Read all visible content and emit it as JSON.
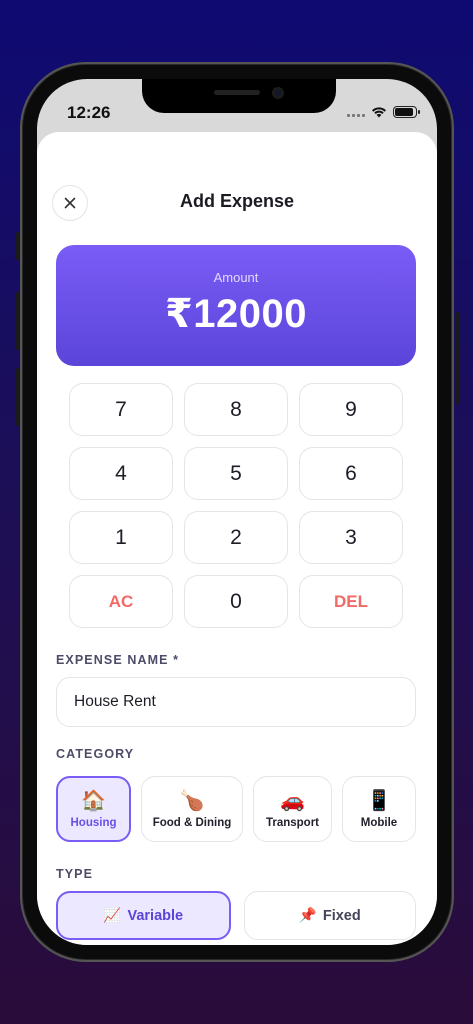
{
  "status": {
    "time": "12:26"
  },
  "header": {
    "title": "Add Expense",
    "close_icon": "close-icon"
  },
  "amount": {
    "label": "Amount",
    "value": "₹12000"
  },
  "keypad": {
    "keys": [
      "7",
      "8",
      "9",
      "4",
      "5",
      "6",
      "1",
      "2",
      "3",
      "AC",
      "0",
      "DEL"
    ]
  },
  "expense_name": {
    "label": "EXPENSE NAME *",
    "value": "House Rent"
  },
  "category": {
    "label": "CATEGORY",
    "items": [
      {
        "icon": "🏠",
        "label": "Housing",
        "selected": true
      },
      {
        "icon": "🍗",
        "label": "Food & Dining",
        "selected": false
      },
      {
        "icon": "🚗",
        "label": "Transport",
        "selected": false
      },
      {
        "icon": "📱",
        "label": "Mobile",
        "selected": false
      }
    ]
  },
  "type": {
    "label": "TYPE",
    "items": [
      {
        "icon": "📈",
        "label": "Variable",
        "selected": true
      },
      {
        "icon": "📌",
        "label": "Fixed",
        "selected": false
      }
    ]
  },
  "colors": {
    "accent": "#7A5CF6",
    "danger": "#F26A66"
  }
}
